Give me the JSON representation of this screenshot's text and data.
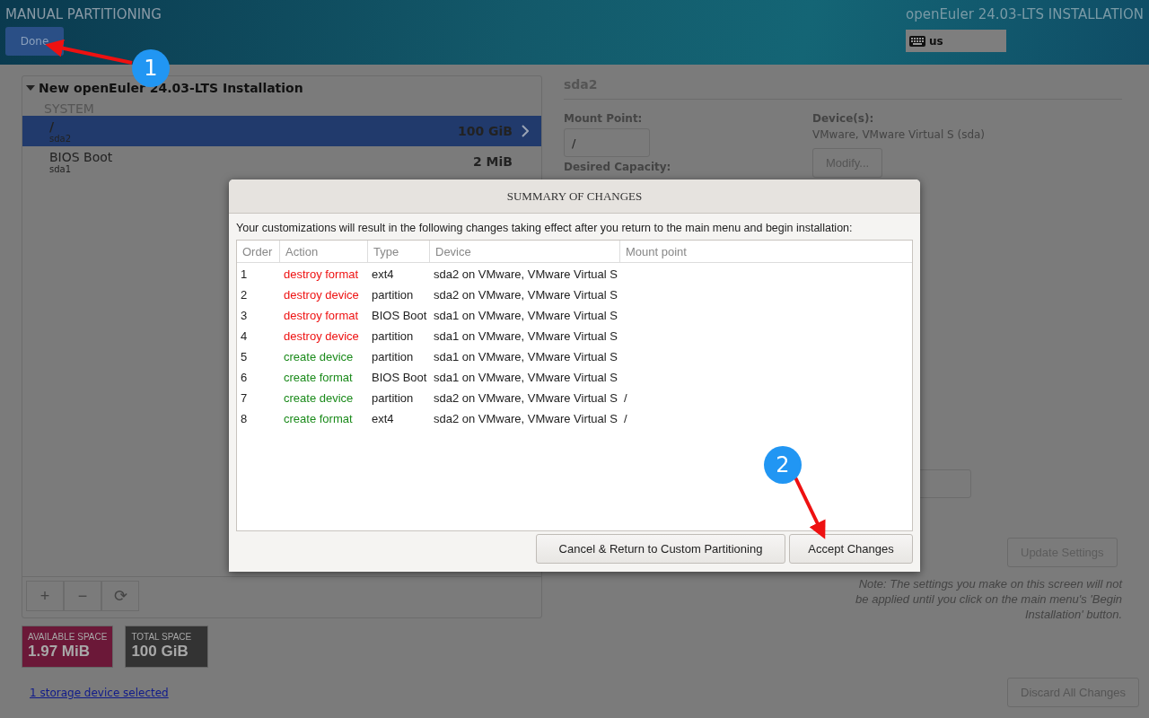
{
  "header": {
    "title": "MANUAL PARTITIONING",
    "done_button": "Done",
    "product": "openEuler 24.03-LTS INSTALLATION",
    "keyboard": "us"
  },
  "partitions": {
    "group": {
      "title": "New openEuler 24.03-LTS Installation",
      "expanded": true
    },
    "section": "SYSTEM",
    "items": [
      {
        "name": "/",
        "device": "sda2",
        "size": "100 GiB",
        "selected": true
      },
      {
        "name": "BIOS Boot",
        "device": "sda1",
        "size": "2 MiB",
        "selected": false
      }
    ],
    "toolbar": [
      "+",
      "−",
      "⟳"
    ]
  },
  "space": [
    {
      "label": "AVAILABLE SPACE",
      "value": "1.97 MiB",
      "color": "#6b1838"
    },
    {
      "label": "TOTAL SPACE",
      "value": "100 GiB",
      "color": "#333333"
    }
  ],
  "storage_link": "1 storage device selected",
  "details": {
    "title": "sda2",
    "mount_label": "Mount Point:",
    "mount_value": "/",
    "capacity_label": "Desired Capacity:",
    "devices_label": "Device(s):",
    "devices_value": "VMware, VMware Virtual S (sda)",
    "modify_button": "Modify...",
    "update_button": "Update Settings",
    "note": "Note:  The settings you make on this screen will not be applied until you click on the main menu's 'Begin Installation' button.",
    "discard_button": "Discard All Changes"
  },
  "dialog": {
    "title": "SUMMARY OF CHANGES",
    "intro": "Your customizations will result in the following changes taking effect after you return to the main menu and begin installation:",
    "columns": [
      "Order",
      "Action",
      "Type",
      "Device",
      "Mount point"
    ],
    "rows": [
      {
        "order": "1",
        "action": "destroy format",
        "kind": "destroy",
        "type": "ext4",
        "device": "sda2 on VMware, VMware Virtual S",
        "mount": ""
      },
      {
        "order": "2",
        "action": "destroy device",
        "kind": "destroy",
        "type": "partition",
        "device": "sda2 on VMware, VMware Virtual S",
        "mount": ""
      },
      {
        "order": "3",
        "action": "destroy format",
        "kind": "destroy",
        "type": "BIOS Boot",
        "device": "sda1 on VMware, VMware Virtual S",
        "mount": ""
      },
      {
        "order": "4",
        "action": "destroy device",
        "kind": "destroy",
        "type": "partition",
        "device": "sda1 on VMware, VMware Virtual S",
        "mount": ""
      },
      {
        "order": "5",
        "action": "create device",
        "kind": "create",
        "type": "partition",
        "device": "sda1 on VMware, VMware Virtual S",
        "mount": ""
      },
      {
        "order": "6",
        "action": "create format",
        "kind": "create",
        "type": "BIOS Boot",
        "device": "sda1 on VMware, VMware Virtual S",
        "mount": ""
      },
      {
        "order": "7",
        "action": "create device",
        "kind": "create",
        "type": "partition",
        "device": "sda2 on VMware, VMware Virtual S",
        "mount": "/"
      },
      {
        "order": "8",
        "action": "create format",
        "kind": "create",
        "type": "ext4",
        "device": "sda2 on VMware, VMware Virtual S",
        "mount": "/"
      }
    ],
    "buttons": [
      "Cancel & Return to Custom Partitioning",
      "Accept Changes"
    ]
  },
  "annotations": [
    {
      "number": "1"
    },
    {
      "number": "2"
    }
  ]
}
